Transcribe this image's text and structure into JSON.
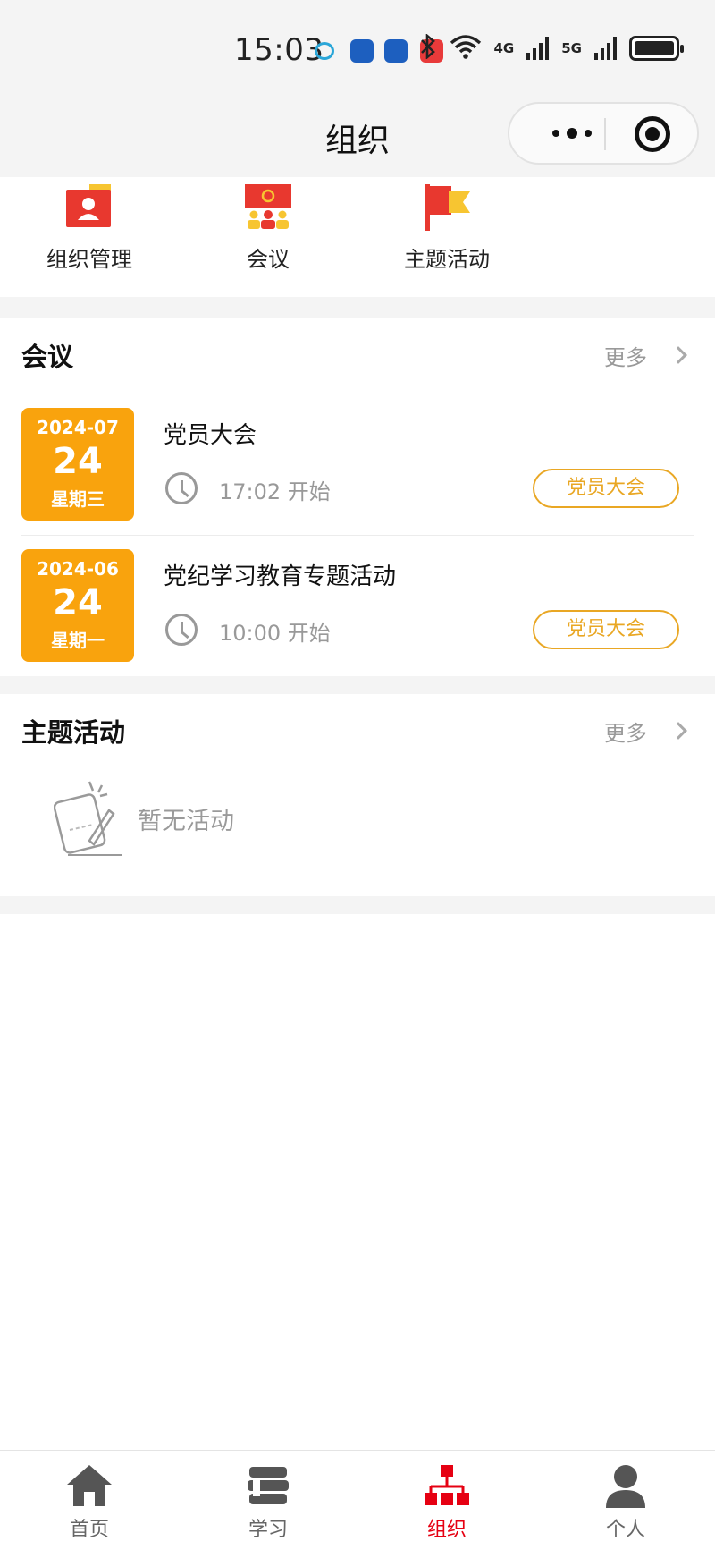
{
  "status_bar": {
    "time": "15:03",
    "net_4g": "4G",
    "net_5g": "5G"
  },
  "nav": {
    "title": "组织"
  },
  "quick_menu": {
    "items": [
      {
        "label": "组织管理",
        "icon": "org-management-icon"
      },
      {
        "label": "会议",
        "icon": "meeting-icon"
      },
      {
        "label": "主题活动",
        "icon": "flag-icon"
      }
    ]
  },
  "meetings": {
    "title": "会议",
    "more": "更多",
    "items": [
      {
        "year_month": "2024-07",
        "day": "24",
        "weekday": "星期三",
        "title": "党员大会",
        "time": "17:02 开始",
        "tag": "党员大会"
      },
      {
        "year_month": "2024-06",
        "day": "24",
        "weekday": "星期一",
        "title": "党纪学习教育专题活动",
        "time": "10:00 开始",
        "tag": "党员大会"
      }
    ]
  },
  "activities": {
    "title": "主题活动",
    "more": "更多",
    "empty_text": "暂无活动"
  },
  "tabbar": {
    "items": [
      {
        "label": "首页",
        "icon": "home-icon",
        "active": false
      },
      {
        "label": "学习",
        "icon": "study-icon",
        "active": false
      },
      {
        "label": "组织",
        "icon": "organization-icon",
        "active": true
      },
      {
        "label": "个人",
        "icon": "person-icon",
        "active": false
      }
    ]
  },
  "colors": {
    "accent_red": "#e60012",
    "date_orange": "#f9a30d",
    "tag_gold": "#e9a724",
    "background_gray": "#f4f4f4"
  }
}
